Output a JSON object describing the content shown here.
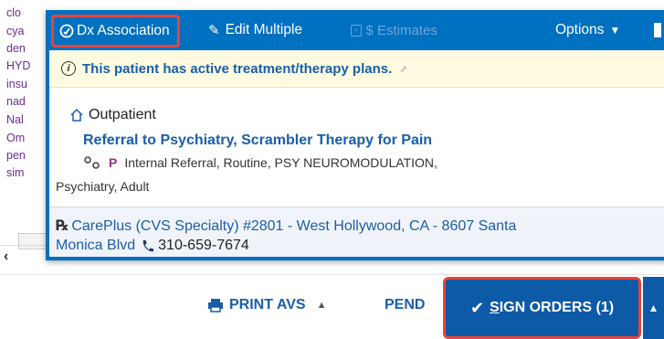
{
  "background_list": {
    "items": [
      "clo",
      "cya",
      "den",
      "HYD",
      "insu",
      "nad",
      "Nal",
      "Om",
      "pen",
      "sim"
    ]
  },
  "toolbar": {
    "dx_association": "Dx Association",
    "edit_multiple": "Edit Multiple",
    "estimates": "$ Estimates",
    "options": "Options"
  },
  "notice": {
    "text": "This patient has active treatment/therapy plans."
  },
  "order": {
    "setting": "Outpatient",
    "title": "Referral to Psychiatry, Scrambler Therapy for Pain",
    "priority_letter": "P",
    "detail_line1": "Internal Referral, Routine, PSY NEUROMODULATION,",
    "detail_line2": "Psychiatry, Adult"
  },
  "pharmacy": {
    "rx_symbol": "℞",
    "line1": "CarePlus (CVS Specialty) #2801 - West Hollywood, CA - 8607 Santa",
    "line2": "Monica Blvd",
    "phone": "310-659-7674"
  },
  "footer": {
    "print_avs": "PRINT AVS",
    "pend": "PEND",
    "sign_orders_prefix": "S",
    "sign_orders_rest": "IGN ORDERS (1)"
  },
  "colors": {
    "popup_blue": "#0070c0",
    "link_blue": "#1b5ea8",
    "highlight_red": "#e8433c",
    "sign_button": "#0d5aa7",
    "med_purple": "#6b2c8f"
  },
  "icons": {
    "dx": "dx-association-icon",
    "edit": "pencil-icon",
    "estimate": "money-icon",
    "info": "info-icon",
    "house": "house-icon",
    "links": "linked-orders-icon",
    "rx": "rx-icon",
    "phone": "phone-icon",
    "print": "printer-icon",
    "check": "checkmark-icon"
  }
}
